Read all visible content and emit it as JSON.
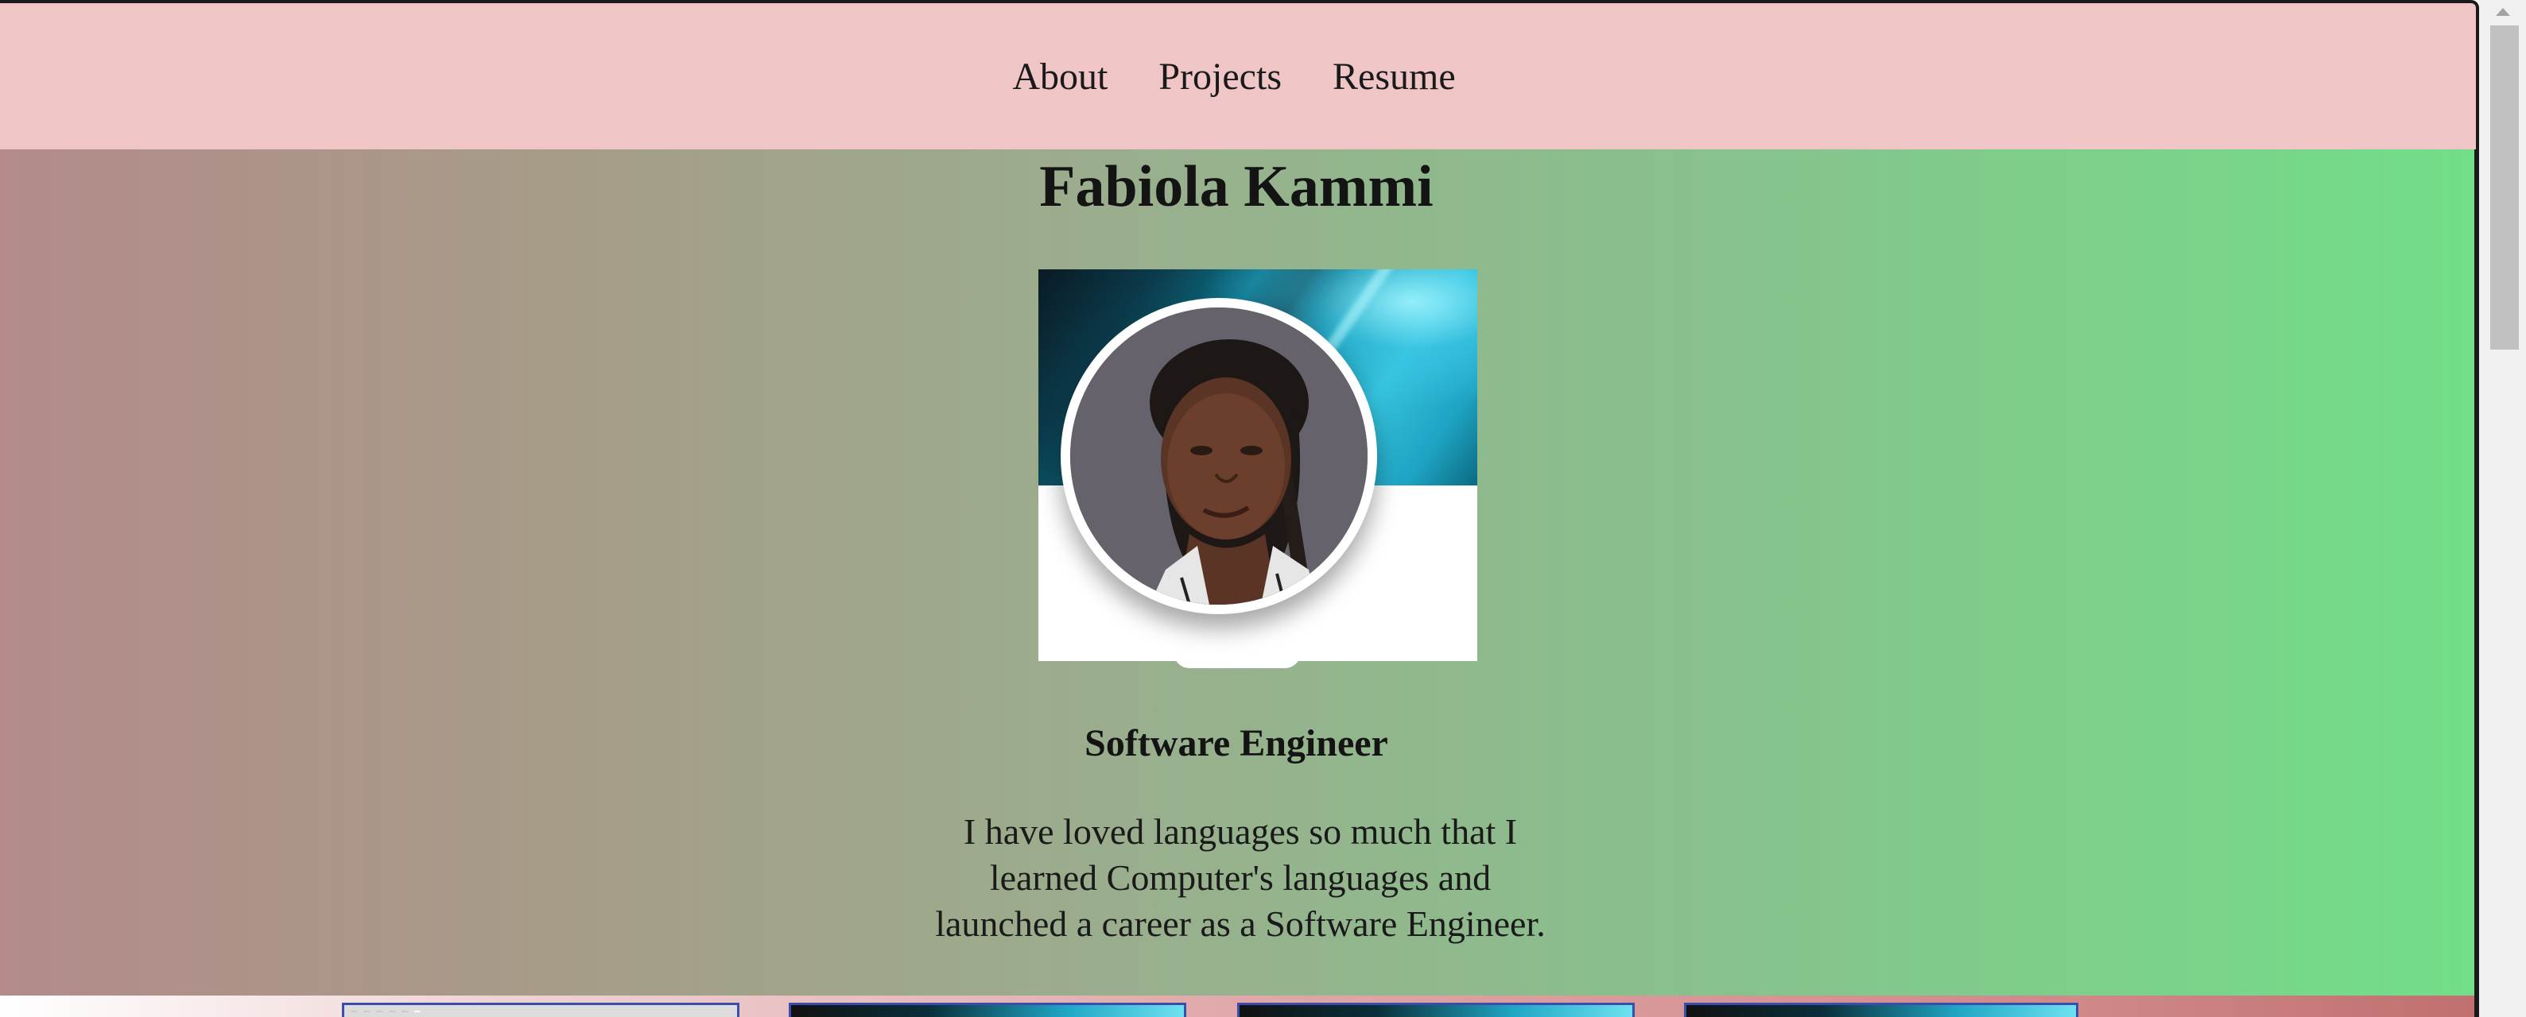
{
  "nav": {
    "items": [
      {
        "label": "About"
      },
      {
        "label": "Projects"
      },
      {
        "label": "Resume"
      }
    ]
  },
  "hero": {
    "name": "Fabiola Kammi",
    "title": "Software Engineer",
    "bio": "I have loved languages so much that I learned Computer's languages and launched a career as a Software Engineer."
  },
  "colors": {
    "nav_background": "#f0c5c6",
    "gradient_left": "#b38b8b",
    "gradient_right": "#72de88"
  },
  "icons": {
    "scroll_up": "chevron-up-icon"
  }
}
